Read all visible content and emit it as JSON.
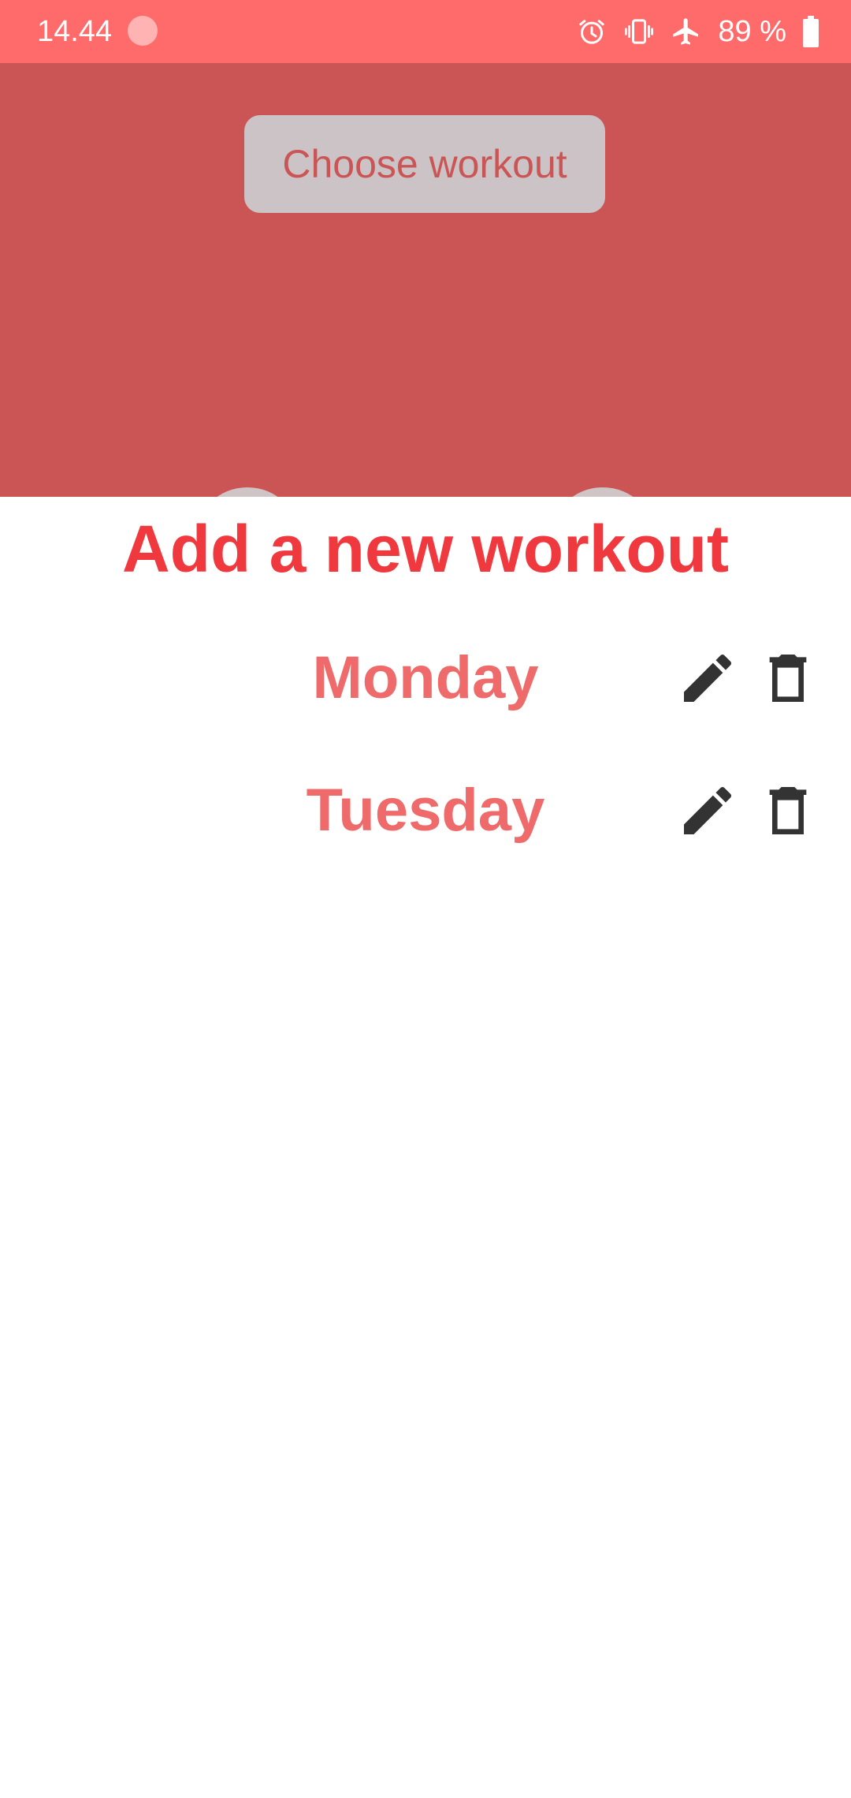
{
  "status_bar": {
    "time": "14.44",
    "battery": "89 %",
    "icons": [
      "alarm-icon",
      "vibrate-icon",
      "airplane-mode-icon",
      "battery-icon"
    ]
  },
  "header": {
    "choose_button_label": "Choose workout"
  },
  "sheet": {
    "title": "Add a new workout",
    "workouts": [
      {
        "name": "Monday"
      },
      {
        "name": "Tuesday"
      }
    ]
  },
  "colors": {
    "status_bar": "#ff6b6b",
    "header_dimmed": "#cb5555",
    "title_red": "#f0393f",
    "workout_text": "#ef6b6b",
    "icon_dark": "#333333",
    "button_bg": "#cbc3c5"
  }
}
